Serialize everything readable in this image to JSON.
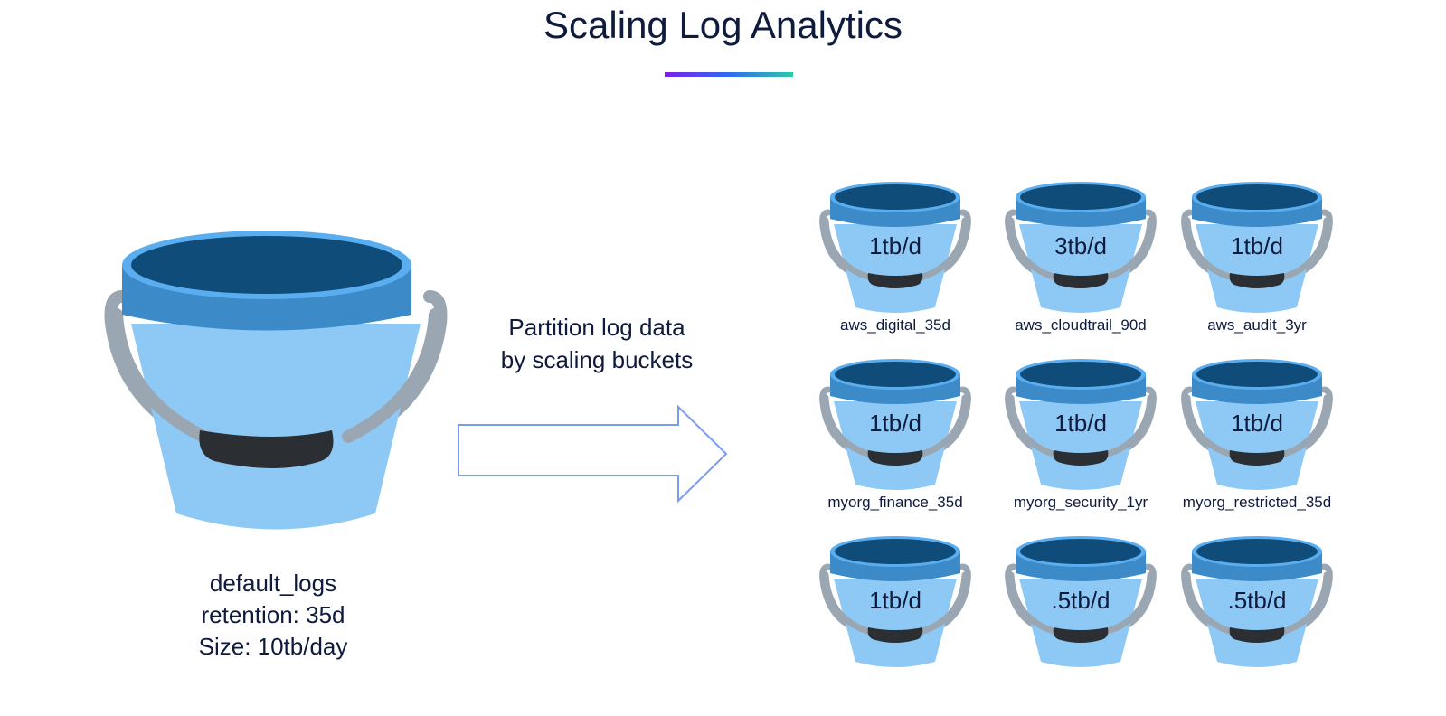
{
  "title": "Scaling Log Analytics",
  "default_bucket": {
    "name": "default_logs",
    "retention": "retention: 35d",
    "size": "Size: 10tb/day"
  },
  "arrow_label": {
    "line1": "Partition log data",
    "line2": "by scaling buckets"
  },
  "buckets": [
    {
      "rate": "1tb/d",
      "name": "aws_digital_35d"
    },
    {
      "rate": "3tb/d",
      "name": "aws_cloudtrail_90d"
    },
    {
      "rate": "1tb/d",
      "name": "aws_audit_3yr"
    },
    {
      "rate": "1tb/d",
      "name": "myorg_finance_35d"
    },
    {
      "rate": "1tb/d",
      "name": "myorg_security_1yr"
    },
    {
      "rate": "1tb/d",
      "name": "myorg_restricted_35d"
    },
    {
      "rate": "1tb/d",
      "name": ""
    },
    {
      "rate": ".5tb/d",
      "name": ""
    },
    {
      "rate": ".5tb/d",
      "name": ""
    }
  ],
  "colors": {
    "rim_inner": "#0f4c7a",
    "rim_band": "#3d8ac8",
    "rim_edge": "#5aaef0",
    "body": "#8ec9f5",
    "handle": "#9aa7b3",
    "grip": "#2b2f33",
    "arrow_stroke": "#7a9cf0",
    "title_underline": [
      "#7b1fe8",
      "#2f6bf0",
      "#2cc9a8"
    ]
  }
}
